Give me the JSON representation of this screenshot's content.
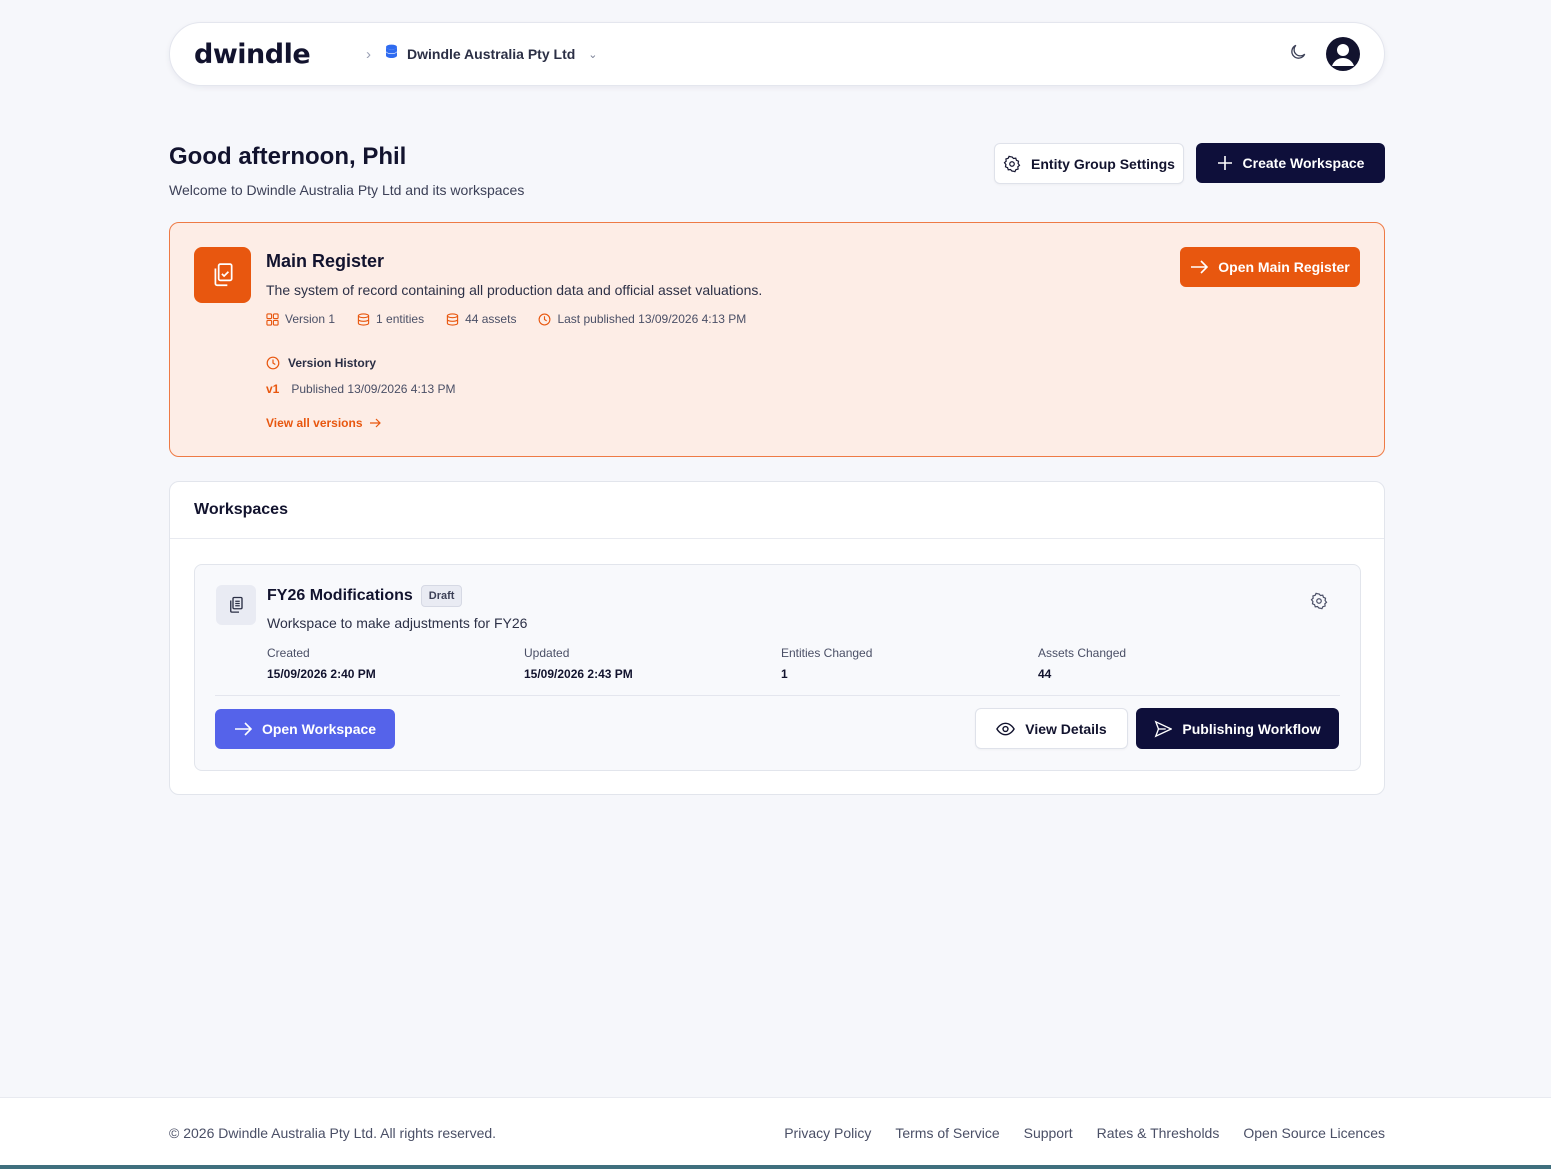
{
  "header": {
    "logo": "dwindle",
    "entity_name": "Dwindle Australia Pty Ltd"
  },
  "greeting": {
    "title": "Good afternoon, Phil",
    "subtitle": "Welcome to Dwindle Australia Pty Ltd and its workspaces"
  },
  "actions": {
    "entity_group_settings": "Entity Group Settings",
    "create_workspace": "Create Workspace"
  },
  "main_register": {
    "title": "Main Register",
    "description": "The system of record containing all production data and official asset valuations.",
    "version": "Version 1",
    "entities": "1 entities",
    "assets": "44 assets",
    "last_published": "Last published 13/09/2026 4:13 PM",
    "version_history_label": "Version History",
    "history": [
      {
        "tag": "v1",
        "text": "Published 13/09/2026 4:13 PM"
      }
    ],
    "view_all_versions": "View all versions",
    "open_button": "Open Main Register"
  },
  "workspaces": {
    "heading": "Workspaces",
    "items": [
      {
        "title": "FY26 Modifications",
        "badge": "Draft",
        "description": "Workspace to make adjustments for FY26",
        "stats": [
          {
            "label": "Created",
            "value": "15/09/2026 2:40 PM"
          },
          {
            "label": "Updated",
            "value": "15/09/2026 2:43 PM"
          },
          {
            "label": "Entities Changed",
            "value": "1"
          },
          {
            "label": "Assets Changed",
            "value": "44"
          }
        ],
        "open_button": "Open Workspace",
        "view_details_button": "View Details",
        "publishing_button": "Publishing Workflow"
      }
    ]
  },
  "footer": {
    "copyright": "© 2026 Dwindle Australia Pty Ltd. All rights reserved.",
    "links": [
      "Privacy Policy",
      "Terms of Service",
      "Support",
      "Rates & Thresholds",
      "Open Source Licences"
    ]
  },
  "colors": {
    "accent_orange": "#e8570f",
    "navy": "#0e0f3a",
    "blue": "#5563ea"
  }
}
